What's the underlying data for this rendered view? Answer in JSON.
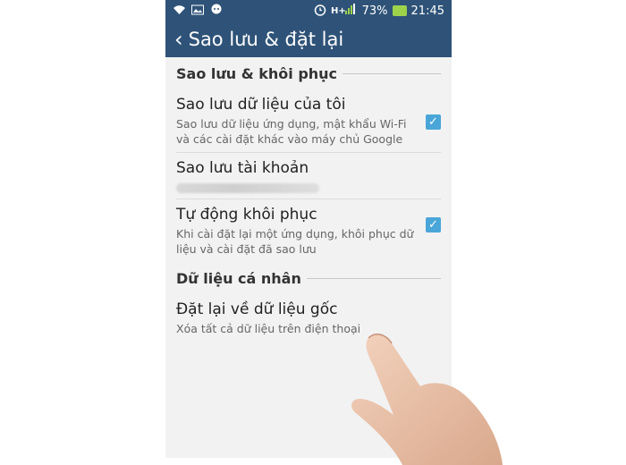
{
  "status_bar": {
    "battery_percent": "73%",
    "time": "21:45",
    "icons": [
      "wifi-icon",
      "image-icon",
      "chat-icon",
      "alarm-icon",
      "signal-icon",
      "battery-icon"
    ]
  },
  "app_bar": {
    "title": "Sao lưu & đặt lại"
  },
  "sections": {
    "backup_restore": {
      "header": "Sao lưu & khôi phục",
      "backup_data": {
        "title": "Sao lưu dữ liệu của tôi",
        "desc": "Sao lưu dữ liệu ứng dụng, mật khẩu Wi-Fi và các cài đặt khác vào máy chủ Google",
        "checked": true
      },
      "backup_account": {
        "title": "Sao lưu tài khoản"
      },
      "auto_restore": {
        "title": "Tự động khôi phục",
        "desc": "Khi cài đặt lại một ứng dụng, khôi phục dữ liệu và cài đặt đã sao lưu",
        "checked": true
      }
    },
    "personal_data": {
      "header": "Dữ liệu cá nhân",
      "factory_reset": {
        "title": "Đặt lại về dữ liệu gốc",
        "desc": "Xóa tất cả dữ liệu trên điện thoại"
      }
    }
  },
  "colors": {
    "app_bar": "#2f5378",
    "checkbox": "#4aa6d8",
    "background": "#f2f2f2"
  }
}
